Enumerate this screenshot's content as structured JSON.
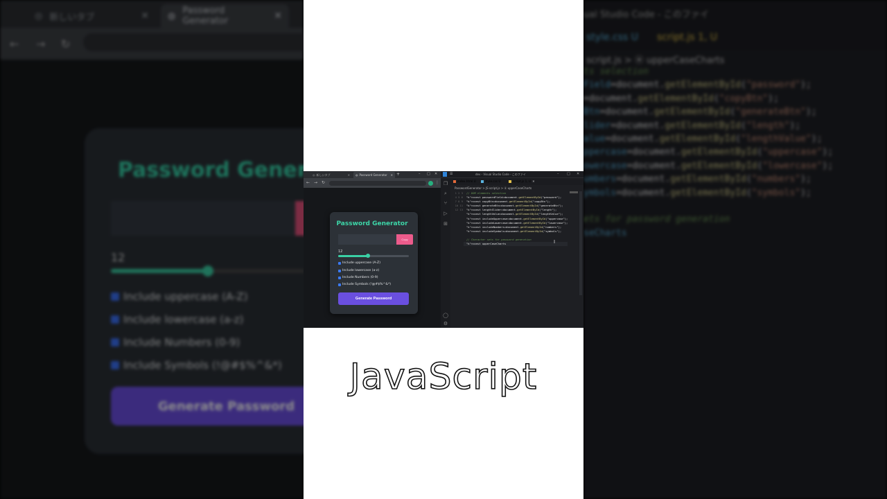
{
  "background": {
    "browser": {
      "tabs": [
        {
          "label": "新しいタブ"
        },
        {
          "label": "Password Generator"
        }
      ],
      "title": "Password Generat",
      "length_value": "12",
      "options": [
        "Include uppercase (A-Z)",
        "Include lowercase (a-z)",
        "Include Numbers (0-9)",
        "Include Symbols (!@#$%^&*)"
      ],
      "generate_label": "Generate Password"
    },
    "editor": {
      "window_title": "ual Studio Code - このファイ",
      "tabs": [
        {
          "label": "style.css U"
        },
        {
          "label": "script.js 1, U"
        }
      ],
      "breadcrumb": "script.js > ⦿ upperCaseCharts",
      "code_lines": [
        {
          "type": "comment",
          "text": "ts selection"
        },
        {
          "var": "Field",
          "fn": "getElementById",
          "arg": "\"password\""
        },
        {
          "var": "",
          "fn": "getElementById",
          "arg": "\"copyBtn\""
        },
        {
          "var": "Btn",
          "fn": "getElementById",
          "arg": "\"generateBtn\""
        },
        {
          "var": "lider",
          "fn": "getElementById",
          "arg": "\"length\""
        },
        {
          "var": "alue",
          "fn": "getElementById",
          "arg": "\"lengthValue\""
        },
        {
          "var": "ppercase",
          "fn": "getElementById",
          "arg": "\"uppercase\""
        },
        {
          "var": "owercase",
          "fn": "getElementById",
          "arg": "\"lowercase\""
        },
        {
          "var": "umbers",
          "fn": "getElementById",
          "arg": "\"numbers\""
        },
        {
          "var": "ymbols",
          "fn": "getElementById",
          "arg": "\"symbols\""
        },
        {
          "type": "blank",
          "text": ""
        },
        {
          "type": "comment",
          "text": "ets for password generation"
        },
        {
          "type": "partial",
          "text": "seCharts"
        }
      ]
    }
  },
  "caption": "JavaScript",
  "screenshot": {
    "browser": {
      "tabs": [
        {
          "label": "新しいタブ"
        },
        {
          "label": "Password Generator"
        }
      ],
      "app": {
        "title": "Password Generator",
        "copy_label": "Copy",
        "length_value": "12",
        "length_fraction": 0.42,
        "options": [
          {
            "label": "Include uppercase (A-Z)",
            "checked": true
          },
          {
            "label": "Include lowercase (a-z)",
            "checked": true
          },
          {
            "label": "Include Numbers (0-9)",
            "checked": true
          },
          {
            "label": "Include Symbols (!@#$%^&*)",
            "checked": true
          }
        ],
        "generate_label": "Generate Password",
        "accent_color": "#3dd6a8",
        "button_color": "#6a4fe0",
        "copy_color": "#ec5b8b"
      }
    },
    "editor": {
      "window_title": "dev - Visual Studio Code - このファイ",
      "tabs": [
        {
          "label": "index.html U",
          "color": "#e46a3a"
        },
        {
          "label": "style.css U",
          "color": "#5ab4e0"
        },
        {
          "label": "script.js 1, U",
          "color": "#e6c34a"
        }
      ],
      "breadcrumb": "PasswordGenerator > JS script.js > ⦿ upperCaseCharts",
      "line_numbers": [
        "1",
        "2",
        "3",
        "4",
        "5",
        "6",
        "7",
        "8",
        "9",
        "10",
        "11",
        "12",
        "13"
      ],
      "lines": [
        "// DOM elements selection",
        "const passwordField=document.getElementById(\"password\");",
        "const copyBtn=document.getElementById(\"copyBtn\");",
        "const generateBtn=document.getElementById(\"generateBtn\");",
        "const lengthSlider=document.getElementById(\"length\");",
        "const lengthValue=document.getElementById(\"lengthValue\");",
        "const includeUppercase=document.getElementById(\"uppercase\");",
        "const includeLowercase=document.getElementById(\"lowercase\");",
        "const includeNumbers=document.getElementById(\"numbers\");",
        "const includeSymbols=document.getElementById(\"symbols\");",
        "",
        "// Character sets for password generation",
        "const upperCaseCharts"
      ]
    }
  }
}
